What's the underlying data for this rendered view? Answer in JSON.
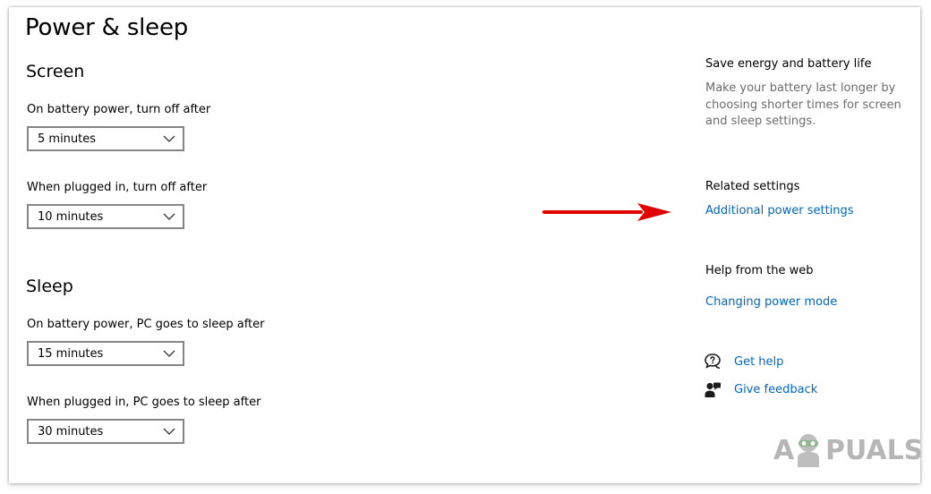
{
  "page": {
    "title": "Power & sleep"
  },
  "screen": {
    "heading": "Screen",
    "battery_label": "On battery power, turn off after",
    "battery_value": "5 minutes",
    "plugged_label": "When plugged in, turn off after",
    "plugged_value": "10 minutes"
  },
  "sleep": {
    "heading": "Sleep",
    "battery_label": "On battery power, PC goes to sleep after",
    "battery_value": "15 minutes",
    "plugged_label": "When plugged in, PC goes to sleep after",
    "plugged_value": "30 minutes"
  },
  "sidebar": {
    "save_energy_heading": "Save energy and battery life",
    "save_energy_desc": "Make your battery last longer by choosing shorter times for screen and sleep settings.",
    "related_heading": "Related settings",
    "additional_power_link": "Additional power settings",
    "help_heading": "Help from the web",
    "changing_power_link": "Changing power mode",
    "get_help_link": "Get help",
    "give_feedback_link": "Give feedback"
  },
  "icons": {
    "chevron": "chevron-down-icon",
    "get_help": "help-chat-icon",
    "give_feedback": "feedback-person-icon",
    "annotation": "red-arrow-icon"
  },
  "colors": {
    "link": "#0067c0",
    "annotation_arrow": "#e00000",
    "secondary_text": "#6b6b6b",
    "dropdown_border": "#858585"
  },
  "watermark": {
    "left": "A",
    "right": "PUALS"
  }
}
